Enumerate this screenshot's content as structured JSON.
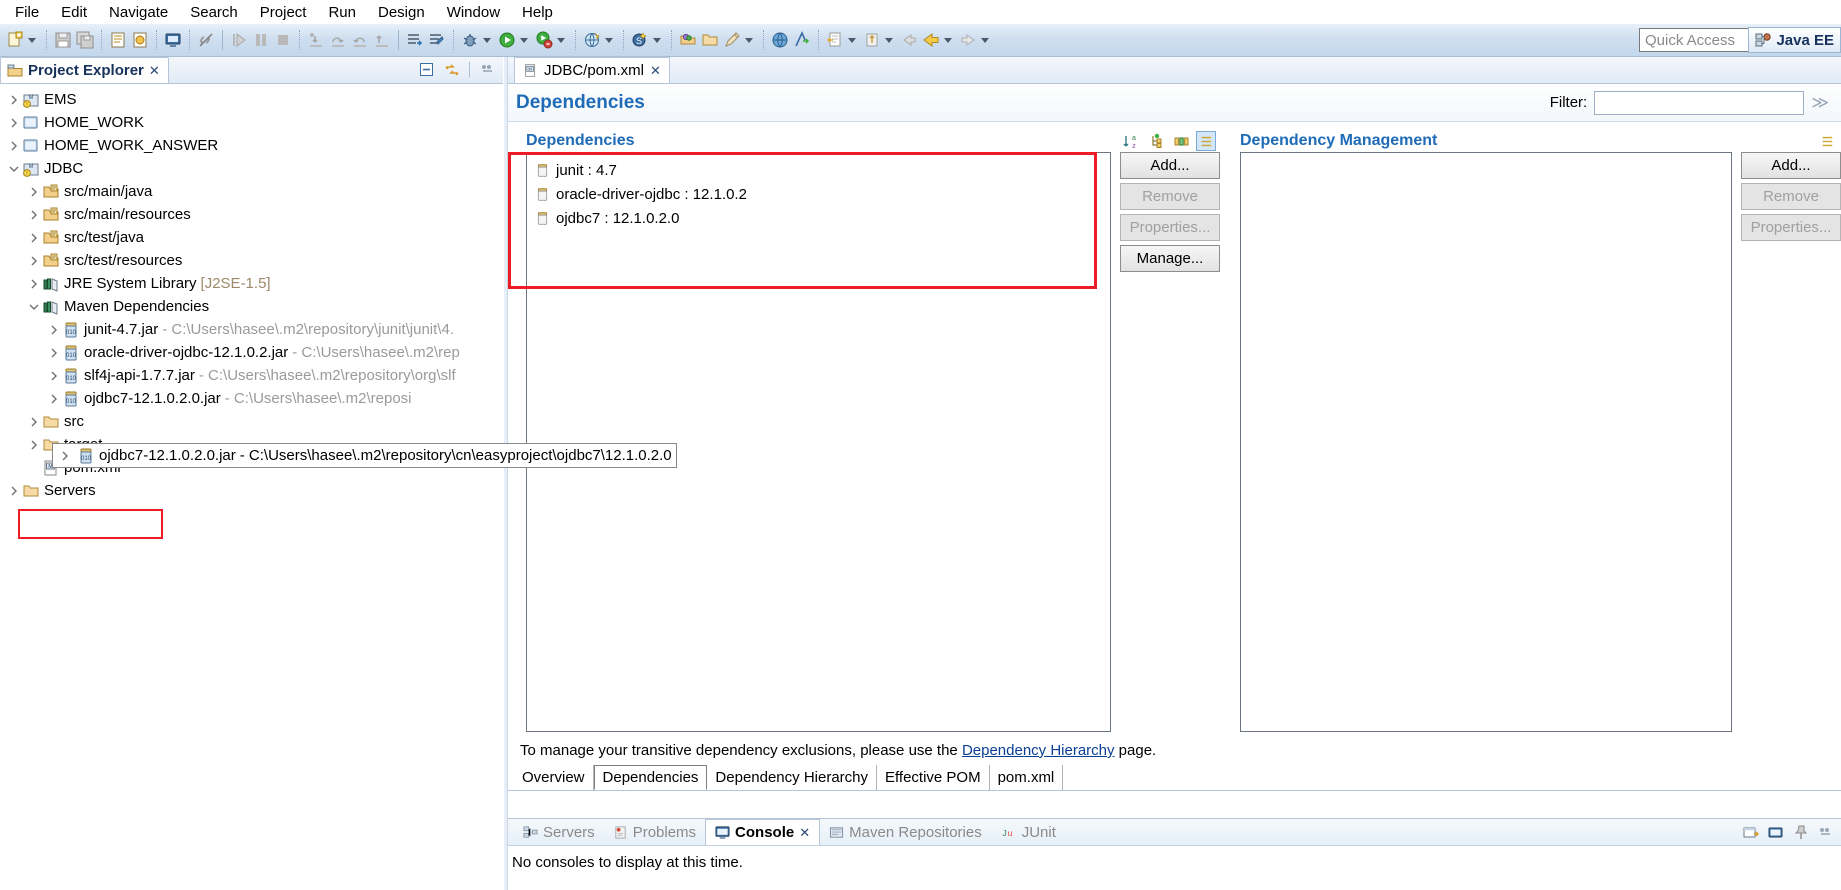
{
  "menubar": {
    "items": [
      "File",
      "Edit",
      "Navigate",
      "Search",
      "Project",
      "Run",
      "Design",
      "Window",
      "Help"
    ]
  },
  "toolbar": {
    "quick_access_placeholder": "Quick Access",
    "perspective_label": "Java EE",
    "icons": [
      "new-wizard-icon",
      "save-icon",
      "save-all-icon",
      "print-icon",
      "build-icon",
      "deploy-icon",
      "link-icon",
      "debug-resume-icon",
      "debug-suspend-icon",
      "debug-terminate-icon",
      "step-into-icon",
      "step-over-icon",
      "step-return-icon",
      "step-out-icon",
      "run-last-tool-icon",
      "external-tools-icon",
      "debug-icon",
      "run-icon",
      "run-as-server-icon",
      "open-browser-icon",
      "new-java-class-icon",
      "new-package-icon",
      "open-type-icon",
      "search-icon",
      "open-task-icon",
      "back-icon",
      "previous-edit-icon",
      "forward-icon"
    ]
  },
  "project_explorer": {
    "tab_label": "Project Explorer",
    "tab_close": "✕",
    "tools": [
      "collapse-all-icon",
      "link-with-editor-icon",
      "view-menu-icon"
    ],
    "tree": [
      {
        "label": "EMS",
        "icon": "maven-project-icon",
        "indent": 0,
        "expanded": false,
        "arrow": true
      },
      {
        "label": "HOME_WORK",
        "icon": "folder-project-icon",
        "indent": 0,
        "expanded": false,
        "arrow": true
      },
      {
        "label": "HOME_WORK_ANSWER",
        "icon": "folder-project-icon",
        "indent": 0,
        "expanded": false,
        "arrow": true
      },
      {
        "label": "JDBC",
        "icon": "maven-project-icon",
        "indent": 0,
        "expanded": true,
        "arrow": true
      },
      {
        "label": "src/main/java",
        "icon": "source-folder-icon",
        "indent": 1,
        "expanded": false,
        "arrow": true
      },
      {
        "label": "src/main/resources",
        "icon": "source-folder-icon",
        "indent": 1,
        "expanded": false,
        "arrow": true
      },
      {
        "label": "src/test/java",
        "icon": "source-folder-icon",
        "indent": 1,
        "expanded": false,
        "arrow": true
      },
      {
        "label": "src/test/resources",
        "icon": "source-folder-icon",
        "indent": 1,
        "expanded": false,
        "arrow": true
      },
      {
        "label": "JRE System Library",
        "suffix": "[J2SE-1.5]",
        "icon": "library-icon",
        "indent": 1,
        "expanded": false,
        "arrow": true
      },
      {
        "label": "Maven Dependencies",
        "icon": "library-icon",
        "indent": 1,
        "expanded": true,
        "arrow": true
      },
      {
        "label": "junit-4.7.jar",
        "suffix": "- C:\\Users\\hasee\\.m2\\repository\\junit\\junit\\4.",
        "icon": "jar-icon",
        "indent": 2,
        "expanded": false,
        "arrow": true
      },
      {
        "label": "oracle-driver-ojdbc-12.1.0.2.jar",
        "suffix": "- C:\\Users\\hasee\\.m2\\rep",
        "icon": "jar-icon",
        "indent": 2,
        "expanded": false,
        "arrow": true
      },
      {
        "label": "slf4j-api-1.7.7.jar",
        "suffix": "- C:\\Users\\hasee\\.m2\\repository\\org\\slf",
        "icon": "jar-icon",
        "indent": 2,
        "expanded": false,
        "arrow": true
      },
      {
        "label": "ojdbc7-12.1.0.2.0.jar",
        "suffix": "- C:\\Users\\hasee\\.m2\\reposi",
        "icon": "jar-icon",
        "indent": 2,
        "expanded": false,
        "arrow": true,
        "selected": true
      },
      {
        "label": "src",
        "icon": "folder-icon",
        "indent": 1,
        "expanded": false,
        "arrow": true
      },
      {
        "label": "target",
        "icon": "folder-icon",
        "indent": 1,
        "expanded": false,
        "arrow": true
      },
      {
        "label": "pom.xml",
        "icon": "pom-file-icon",
        "indent": 1,
        "expanded": false,
        "arrow": false,
        "highlighted": true
      },
      {
        "label": "Servers",
        "icon": "folder-icon",
        "indent": 0,
        "expanded": false,
        "arrow": true
      }
    ],
    "tooltip": {
      "name": "ojdbc7-12.1.0.2.0.jar",
      "path": "- C:\\Users\\hasee\\.m2\\repository\\cn\\easyproject\\ojdbc7\\12.1.0.2.0"
    }
  },
  "editor": {
    "tab_label": "JDBC/pom.xml",
    "tab_close": "✕",
    "page_title": "Dependencies",
    "filter": {
      "label": "Filter:",
      "value": "",
      "placeholder": ""
    },
    "dependencies_section": {
      "title": "Dependencies",
      "tools": [
        "sort-icon",
        "hierarchy-icon",
        "columns-icon",
        "show-groupid-icon"
      ],
      "items": [
        {
          "artifact": "junit",
          "version": "4.7",
          "display": "junit : 4.7"
        },
        {
          "artifact": "oracle-driver-ojdbc",
          "version": "12.1.0.2",
          "display": "oracle-driver-ojdbc : 12.1.0.2"
        },
        {
          "artifact": "ojdbc7",
          "version": "12.1.0.2.0",
          "display": "ojdbc7 : 12.1.0.2.0"
        }
      ],
      "buttons": [
        {
          "label": "Add...",
          "enabled": true
        },
        {
          "label": "Remove",
          "enabled": false
        },
        {
          "label": "Properties...",
          "enabled": false
        },
        {
          "label": "Manage...",
          "enabled": true
        }
      ]
    },
    "dependency_management_section": {
      "title": "Dependency Management",
      "items": [],
      "buttons": [
        {
          "label": "Add...",
          "enabled": true
        },
        {
          "label": "Remove",
          "enabled": false
        },
        {
          "label": "Properties...",
          "enabled": false
        }
      ]
    },
    "hint": {
      "prefix": "To manage your transitive dependency exclusions, please use the ",
      "link": "Dependency Hierarchy",
      "suffix": " page."
    },
    "form_tabs": [
      {
        "label": "Overview",
        "active": false
      },
      {
        "label": "Dependencies",
        "active": true
      },
      {
        "label": "Dependency Hierarchy",
        "active": false
      },
      {
        "label": "Effective POM",
        "active": false
      },
      {
        "label": "pom.xml",
        "active": false
      }
    ]
  },
  "console": {
    "tabs": [
      {
        "label": "Servers",
        "icon": "servers-icon",
        "active": false
      },
      {
        "label": "Problems",
        "icon": "problems-icon",
        "active": false
      },
      {
        "label": "Console",
        "icon": "console-icon",
        "active": true,
        "close": "✕"
      },
      {
        "label": "Maven Repositories",
        "icon": "maven-repo-icon",
        "active": false
      },
      {
        "label": "JUnit",
        "icon": "junit-icon",
        "active": false
      }
    ],
    "message": "No consoles to display at this time.",
    "tools": [
      "open-console-icon",
      "display-console-icon",
      "pin-console-icon",
      "console-menu-icon"
    ]
  },
  "colors": {
    "accent_blue": "#1f6bb8",
    "highlight_red": "#ee1c25",
    "link_blue": "#0b3f96",
    "tab_bg": "#e1ebf6"
  }
}
